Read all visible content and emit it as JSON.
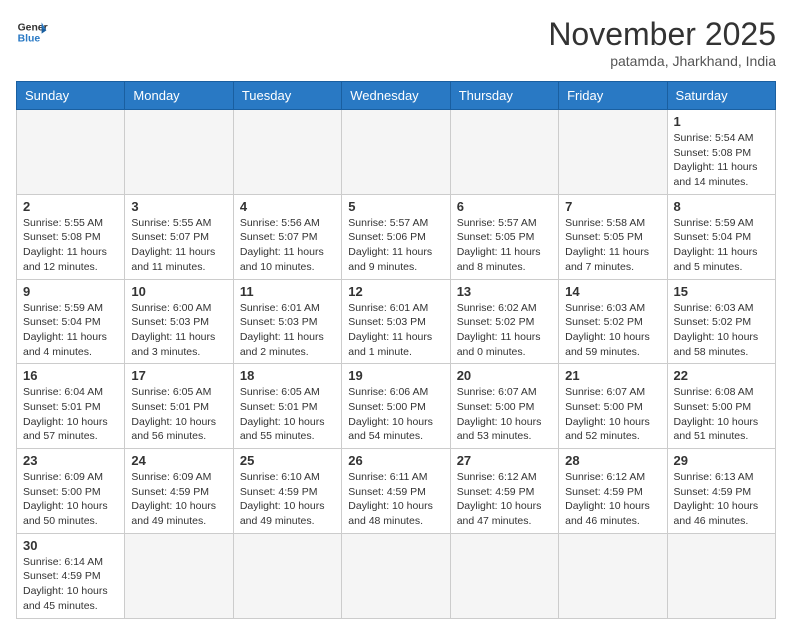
{
  "header": {
    "logo_general": "General",
    "logo_blue": "Blue",
    "month_year": "November 2025",
    "location": "patamda, Jharkhand, India"
  },
  "weekdays": [
    "Sunday",
    "Monday",
    "Tuesday",
    "Wednesday",
    "Thursday",
    "Friday",
    "Saturday"
  ],
  "weeks": [
    [
      {
        "day": "",
        "info": ""
      },
      {
        "day": "",
        "info": ""
      },
      {
        "day": "",
        "info": ""
      },
      {
        "day": "",
        "info": ""
      },
      {
        "day": "",
        "info": ""
      },
      {
        "day": "",
        "info": ""
      },
      {
        "day": "1",
        "info": "Sunrise: 5:54 AM\nSunset: 5:08 PM\nDaylight: 11 hours\nand 14 minutes."
      }
    ],
    [
      {
        "day": "2",
        "info": "Sunrise: 5:55 AM\nSunset: 5:08 PM\nDaylight: 11 hours\nand 12 minutes."
      },
      {
        "day": "3",
        "info": "Sunrise: 5:55 AM\nSunset: 5:07 PM\nDaylight: 11 hours\nand 11 minutes."
      },
      {
        "day": "4",
        "info": "Sunrise: 5:56 AM\nSunset: 5:07 PM\nDaylight: 11 hours\nand 10 minutes."
      },
      {
        "day": "5",
        "info": "Sunrise: 5:57 AM\nSunset: 5:06 PM\nDaylight: 11 hours\nand 9 minutes."
      },
      {
        "day": "6",
        "info": "Sunrise: 5:57 AM\nSunset: 5:05 PM\nDaylight: 11 hours\nand 8 minutes."
      },
      {
        "day": "7",
        "info": "Sunrise: 5:58 AM\nSunset: 5:05 PM\nDaylight: 11 hours\nand 7 minutes."
      },
      {
        "day": "8",
        "info": "Sunrise: 5:59 AM\nSunset: 5:04 PM\nDaylight: 11 hours\nand 5 minutes."
      }
    ],
    [
      {
        "day": "9",
        "info": "Sunrise: 5:59 AM\nSunset: 5:04 PM\nDaylight: 11 hours\nand 4 minutes."
      },
      {
        "day": "10",
        "info": "Sunrise: 6:00 AM\nSunset: 5:03 PM\nDaylight: 11 hours\nand 3 minutes."
      },
      {
        "day": "11",
        "info": "Sunrise: 6:01 AM\nSunset: 5:03 PM\nDaylight: 11 hours\nand 2 minutes."
      },
      {
        "day": "12",
        "info": "Sunrise: 6:01 AM\nSunset: 5:03 PM\nDaylight: 11 hours\nand 1 minute."
      },
      {
        "day": "13",
        "info": "Sunrise: 6:02 AM\nSunset: 5:02 PM\nDaylight: 11 hours\nand 0 minutes."
      },
      {
        "day": "14",
        "info": "Sunrise: 6:03 AM\nSunset: 5:02 PM\nDaylight: 10 hours\nand 59 minutes."
      },
      {
        "day": "15",
        "info": "Sunrise: 6:03 AM\nSunset: 5:02 PM\nDaylight: 10 hours\nand 58 minutes."
      }
    ],
    [
      {
        "day": "16",
        "info": "Sunrise: 6:04 AM\nSunset: 5:01 PM\nDaylight: 10 hours\nand 57 minutes."
      },
      {
        "day": "17",
        "info": "Sunrise: 6:05 AM\nSunset: 5:01 PM\nDaylight: 10 hours\nand 56 minutes."
      },
      {
        "day": "18",
        "info": "Sunrise: 6:05 AM\nSunset: 5:01 PM\nDaylight: 10 hours\nand 55 minutes."
      },
      {
        "day": "19",
        "info": "Sunrise: 6:06 AM\nSunset: 5:00 PM\nDaylight: 10 hours\nand 54 minutes."
      },
      {
        "day": "20",
        "info": "Sunrise: 6:07 AM\nSunset: 5:00 PM\nDaylight: 10 hours\nand 53 minutes."
      },
      {
        "day": "21",
        "info": "Sunrise: 6:07 AM\nSunset: 5:00 PM\nDaylight: 10 hours\nand 52 minutes."
      },
      {
        "day": "22",
        "info": "Sunrise: 6:08 AM\nSunset: 5:00 PM\nDaylight: 10 hours\nand 51 minutes."
      }
    ],
    [
      {
        "day": "23",
        "info": "Sunrise: 6:09 AM\nSunset: 5:00 PM\nDaylight: 10 hours\nand 50 minutes."
      },
      {
        "day": "24",
        "info": "Sunrise: 6:09 AM\nSunset: 4:59 PM\nDaylight: 10 hours\nand 49 minutes."
      },
      {
        "day": "25",
        "info": "Sunrise: 6:10 AM\nSunset: 4:59 PM\nDaylight: 10 hours\nand 49 minutes."
      },
      {
        "day": "26",
        "info": "Sunrise: 6:11 AM\nSunset: 4:59 PM\nDaylight: 10 hours\nand 48 minutes."
      },
      {
        "day": "27",
        "info": "Sunrise: 6:12 AM\nSunset: 4:59 PM\nDaylight: 10 hours\nand 47 minutes."
      },
      {
        "day": "28",
        "info": "Sunrise: 6:12 AM\nSunset: 4:59 PM\nDaylight: 10 hours\nand 46 minutes."
      },
      {
        "day": "29",
        "info": "Sunrise: 6:13 AM\nSunset: 4:59 PM\nDaylight: 10 hours\nand 46 minutes."
      }
    ],
    [
      {
        "day": "30",
        "info": "Sunrise: 6:14 AM\nSunset: 4:59 PM\nDaylight: 10 hours\nand 45 minutes."
      },
      {
        "day": "",
        "info": ""
      },
      {
        "day": "",
        "info": ""
      },
      {
        "day": "",
        "info": ""
      },
      {
        "day": "",
        "info": ""
      },
      {
        "day": "",
        "info": ""
      },
      {
        "day": "",
        "info": ""
      }
    ]
  ]
}
